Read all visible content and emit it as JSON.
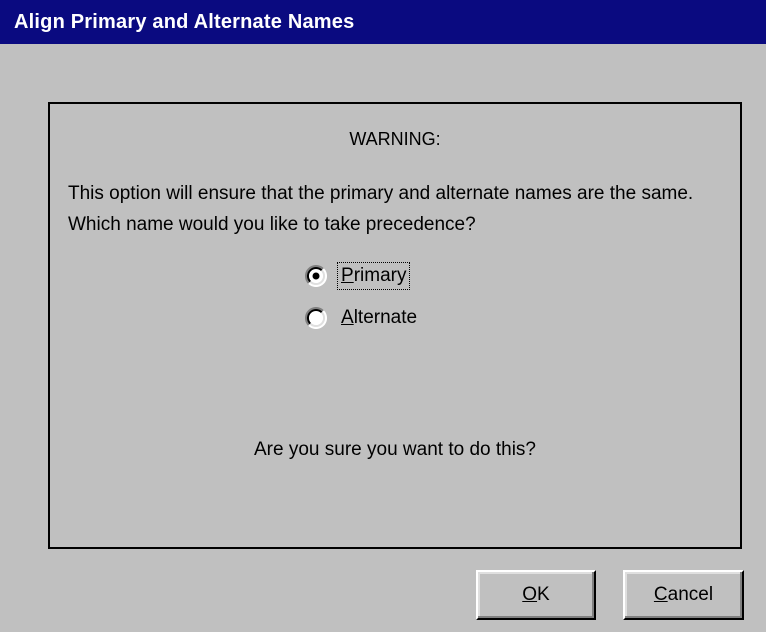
{
  "window": {
    "title": "Align Primary and Alternate Names"
  },
  "panel": {
    "warning_title": "WARNING:",
    "message": "This option will ensure that the primary and alternate names are the same.  Which name would you like to take precedence?",
    "options": [
      {
        "label": "Primary",
        "selected": true,
        "focused": true
      },
      {
        "label": "Alternate",
        "selected": false,
        "focused": false
      }
    ],
    "confirm_text": "Are you sure you want to do this?"
  },
  "buttons": {
    "ok_label": "OK",
    "cancel_label": "Cancel"
  },
  "colors": {
    "titlebar": "#0a0a80",
    "face": "#c0c0c0",
    "title_text": "#ffffff"
  }
}
